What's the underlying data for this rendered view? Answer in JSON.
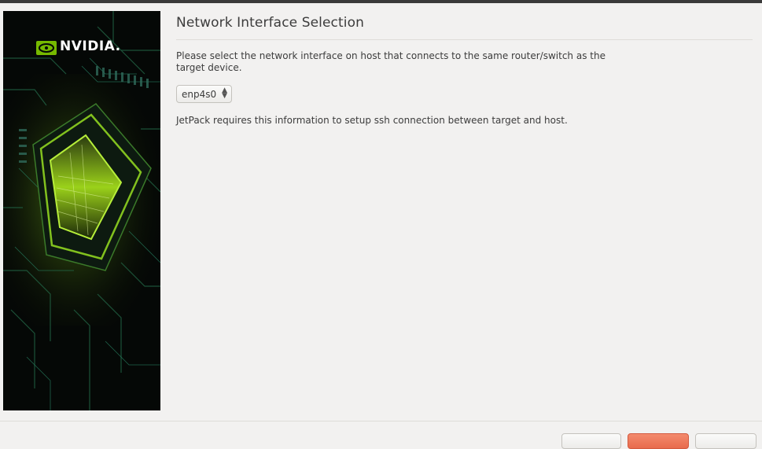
{
  "header": {
    "title": "Network Interface Selection"
  },
  "content": {
    "description": "Please select the network interface on host that connects to the same router/switch as the target device.",
    "interface_select": {
      "value": "enp4s0"
    },
    "info": "JetPack requires this information to setup ssh connection between target and host."
  },
  "branding": {
    "logo_text": "NVIDIA.",
    "accent": "#76b900"
  },
  "colors": {
    "background": "#f2f1f0",
    "primary_button": "#e86b4d"
  }
}
